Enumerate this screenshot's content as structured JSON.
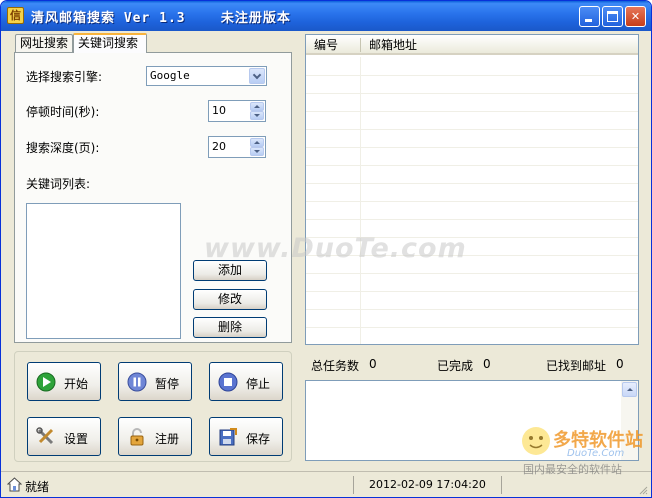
{
  "window": {
    "title": "清风邮箱搜索 Ver 1.3    未注册版本",
    "icon": "app-icon"
  },
  "tabs": [
    {
      "label": "网址搜索",
      "active": false
    },
    {
      "label": "关键词搜索",
      "active": true
    }
  ],
  "form": {
    "engine_label": "选择搜索引擎:",
    "engine_value": "Google",
    "pause_label": "停顿时间(秒):",
    "pause_value": "10",
    "depth_label": "搜索深度(页):",
    "depth_value": "20",
    "keywords_label": "关键词列表:"
  },
  "keyword_buttons": {
    "add": "添加",
    "edit": "修改",
    "delete": "删除"
  },
  "actions": {
    "start": "开始",
    "pause": "暂停",
    "stop": "停止",
    "settings": "设置",
    "register": "注册",
    "save": "保存"
  },
  "results_table": {
    "columns": [
      "编号",
      "邮箱地址"
    ],
    "rows": []
  },
  "stats": {
    "total_label": "总任务数",
    "total_value": "0",
    "done_label": "已完成",
    "done_value": "0",
    "found_label": "已找到邮址",
    "found_value": "0"
  },
  "statusbar": {
    "text": "就绪",
    "datetime": "2012-02-09  17:04:20"
  },
  "watermark": {
    "center_text": "www.DuoTe.com",
    "logo_text": "多特软件站",
    "logo_url": "DuoTe.Com",
    "logo_slogan": "国内最安全的软件站"
  },
  "colors": {
    "titlebar": "#2a74ec",
    "window_bg": "#ece9d8",
    "border": "#7f9db9",
    "tab_highlight": "#f8b33c"
  }
}
